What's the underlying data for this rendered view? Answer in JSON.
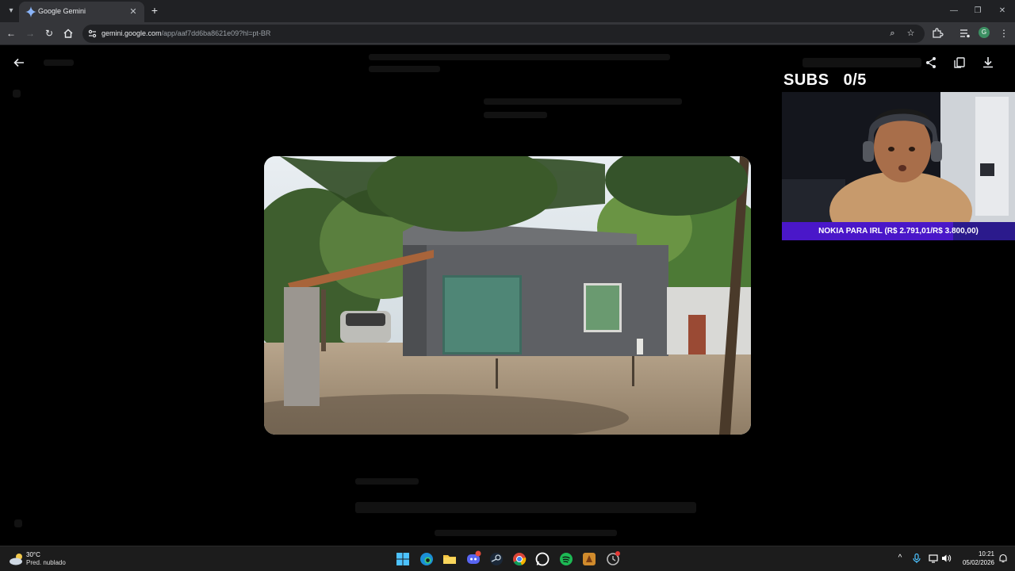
{
  "browser": {
    "tab_title": "Google Gemini",
    "url_host": "gemini.google.com",
    "url_path": "/app/aaf7dd6ba8621e09?hl=pt-BR",
    "profile_initial": "G"
  },
  "overlay": {
    "subs_label": "SUBS",
    "subs_count": "0/5",
    "goal_text": "NOKIA PARA IRL (R$ 2.791,01/R$ 3.800,00)",
    "goal_progress": 0.7345
  },
  "taskbar": {
    "weather_temp": "30°C",
    "weather_desc": "Pred. nublado",
    "time": "10:21",
    "date": "05/02/2026"
  },
  "colors": {
    "accent_goal": "#4a17c9",
    "chrome_dark": "#202124",
    "chrome_toolbar": "#35363a"
  }
}
